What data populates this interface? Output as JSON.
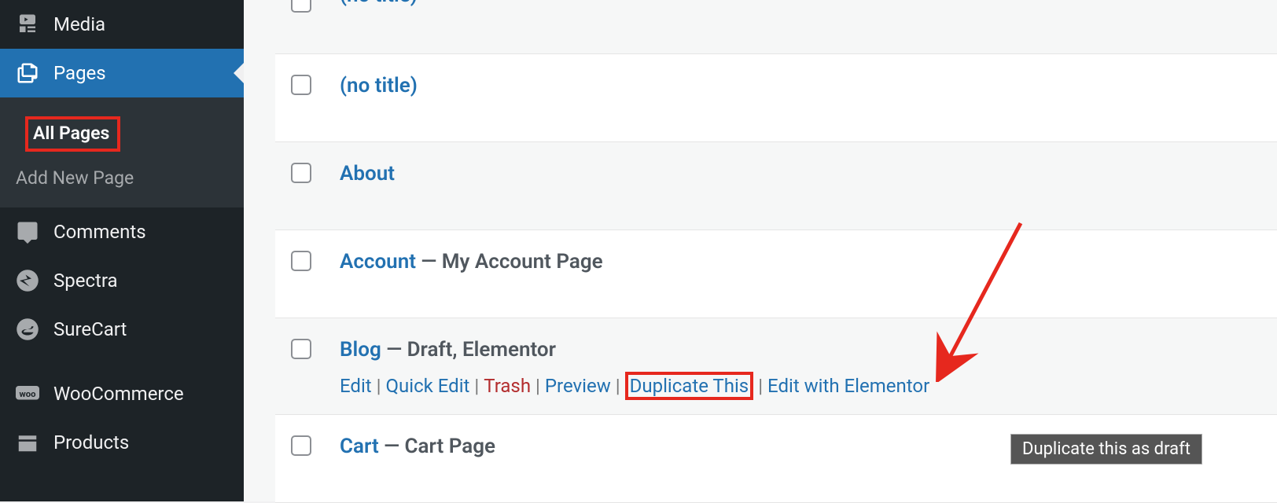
{
  "sidebar": {
    "items": [
      {
        "label": "Media",
        "icon": "media-icon"
      },
      {
        "label": "Pages",
        "icon": "pages-icon",
        "active": true
      },
      {
        "label": "Comments",
        "icon": "comments-icon"
      },
      {
        "label": "Spectra",
        "icon": "spectra-icon"
      },
      {
        "label": "SureCart",
        "icon": "surecart-icon"
      },
      {
        "label": "WooCommerce",
        "icon": "woo-icon"
      },
      {
        "label": "Products",
        "icon": "products-icon"
      }
    ],
    "submenu": {
      "all_pages": "All Pages",
      "add_new": "Add New Page"
    }
  },
  "pages": {
    "row0": {
      "title": "(no title)"
    },
    "row1": {
      "title": "(no title)"
    },
    "row2": {
      "title": "About"
    },
    "row3": {
      "title": "Account",
      "suffix": " — My Account Page"
    },
    "row4": {
      "title": "Blog",
      "suffix": " — Draft, Elementor",
      "actions": {
        "edit": "Edit",
        "quick_edit": "Quick Edit",
        "trash": "Trash",
        "preview": "Preview",
        "duplicate": "Duplicate This",
        "elementor": "Edit with Elementor"
      }
    },
    "row5": {
      "title": "Cart",
      "suffix": " — Cart Page"
    }
  },
  "tooltip": "Duplicate this as draft",
  "colors": {
    "accent": "#2271b1",
    "highlight": "#e6281e",
    "sidebar_bg": "#1d2327"
  }
}
